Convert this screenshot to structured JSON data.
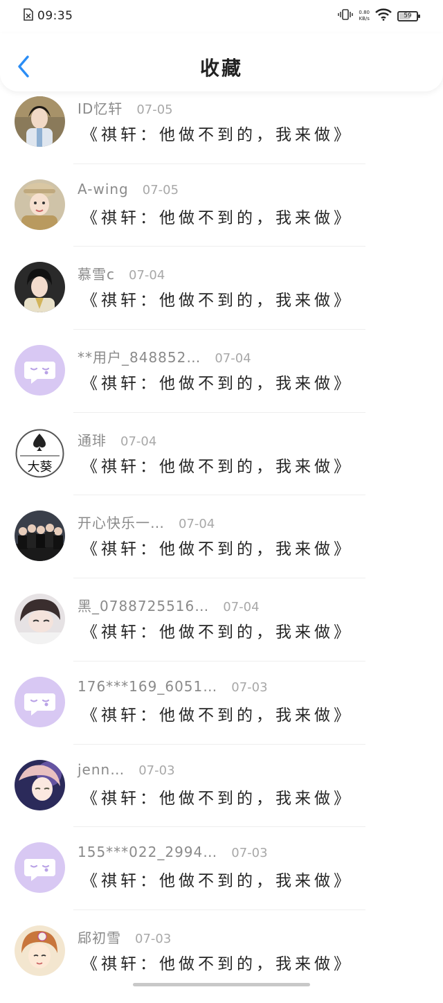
{
  "status_bar": {
    "time": "09:35",
    "net_speed_value": "0.80",
    "net_speed_unit": "KB/s",
    "battery_level": "59"
  },
  "header": {
    "title": "收藏",
    "back_icon": "chevron-left-icon"
  },
  "colors": {
    "accent": "#2a8df5",
    "default_avatar": "#d8c8f3"
  },
  "items": [
    {
      "user": "ID忆轩",
      "date": "07-05",
      "title": "《祺轩：他做不到的，我来做》",
      "avatar": "photo"
    },
    {
      "user": "A-wing",
      "date": "07-05",
      "title": "《祺轩：他做不到的，我来做》",
      "avatar": "photo"
    },
    {
      "user": "慕雪c",
      "date": "07-04",
      "title": "《祺轩：他做不到的，我来做》",
      "avatar": "photo"
    },
    {
      "user": "**用户_848852…",
      "date": "07-04",
      "title": "《祺轩：他做不到的，我来做》",
      "avatar": "default"
    },
    {
      "user": "通琲",
      "date": "07-04",
      "title": "《祺轩：他做不到的，我来做》",
      "avatar": "logo",
      "avatar_text": "大葵"
    },
    {
      "user": "开心快乐一…",
      "date": "07-04",
      "title": "《祺轩：他做不到的，我来做》",
      "avatar": "photo"
    },
    {
      "user": "黑_0788725516…",
      "date": "07-04",
      "title": "《祺轩：他做不到的，我来做》",
      "avatar": "photo"
    },
    {
      "user": "176***169_6051…",
      "date": "07-03",
      "title": "《祺轩：他做不到的，我来做》",
      "avatar": "default"
    },
    {
      "user": "jenn…",
      "date": "07-03",
      "title": "《祺轩：他做不到的，我来做》",
      "avatar": "photo"
    },
    {
      "user": "155***022_2994…",
      "date": "07-03",
      "title": "《祺轩：他做不到的，我来做》",
      "avatar": "default"
    },
    {
      "user": "郈初雪",
      "date": "07-03",
      "title": "《祺轩：他做不到的，我来做》",
      "avatar": "photo"
    }
  ]
}
